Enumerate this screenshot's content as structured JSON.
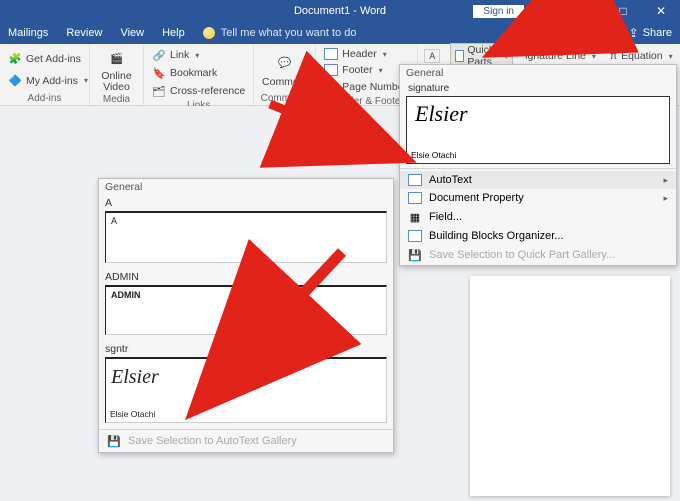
{
  "title": "Document1 - Word",
  "signin": "Sign in",
  "share": "Share",
  "tabs": {
    "mailings": "Mailings",
    "review": "Review",
    "view": "View",
    "help": "Help"
  },
  "tell_me": "Tell me what you want to do",
  "ribbon": {
    "addins": {
      "get": "Get Add-ins",
      "my": "My Add-ins",
      "label": "Add-ins"
    },
    "media": {
      "online_video": "Online\nVideo",
      "label": "Media"
    },
    "links": {
      "link": "Link",
      "bookmark": "Bookmark",
      "crossref": "Cross-reference",
      "label": "Links"
    },
    "comments": {
      "comment": "Comment",
      "label": "Comments"
    },
    "headerfooter": {
      "header": "Header",
      "footer": "Footer",
      "pagenum": "Page Number",
      "label": "Header & Footer"
    },
    "right": {
      "quickparts": "Quick Parts",
      "sigline": "ignature Line",
      "equation": "Equation"
    }
  },
  "qp_flyout": {
    "general": "General",
    "entry_label": "signature",
    "script_name": "Elsier",
    "fine_print": "Elsie Otachi",
    "menu": {
      "autotext": "AutoText",
      "docprop": "Document Property",
      "field": "Field...",
      "bbo": "Building Blocks Organizer...",
      "save": "Save Selection to Quick Part Gallery..."
    }
  },
  "at_flyout": {
    "general": "General",
    "a_label": "A",
    "a_content": "A",
    "admin_label": "ADMIN",
    "admin_content": "ADMIN",
    "sgntr_label": "sgntr",
    "script_name": "Elsier",
    "fine_print": "Elsie Otachi",
    "save": "Save Selection to AutoText Gallery"
  }
}
